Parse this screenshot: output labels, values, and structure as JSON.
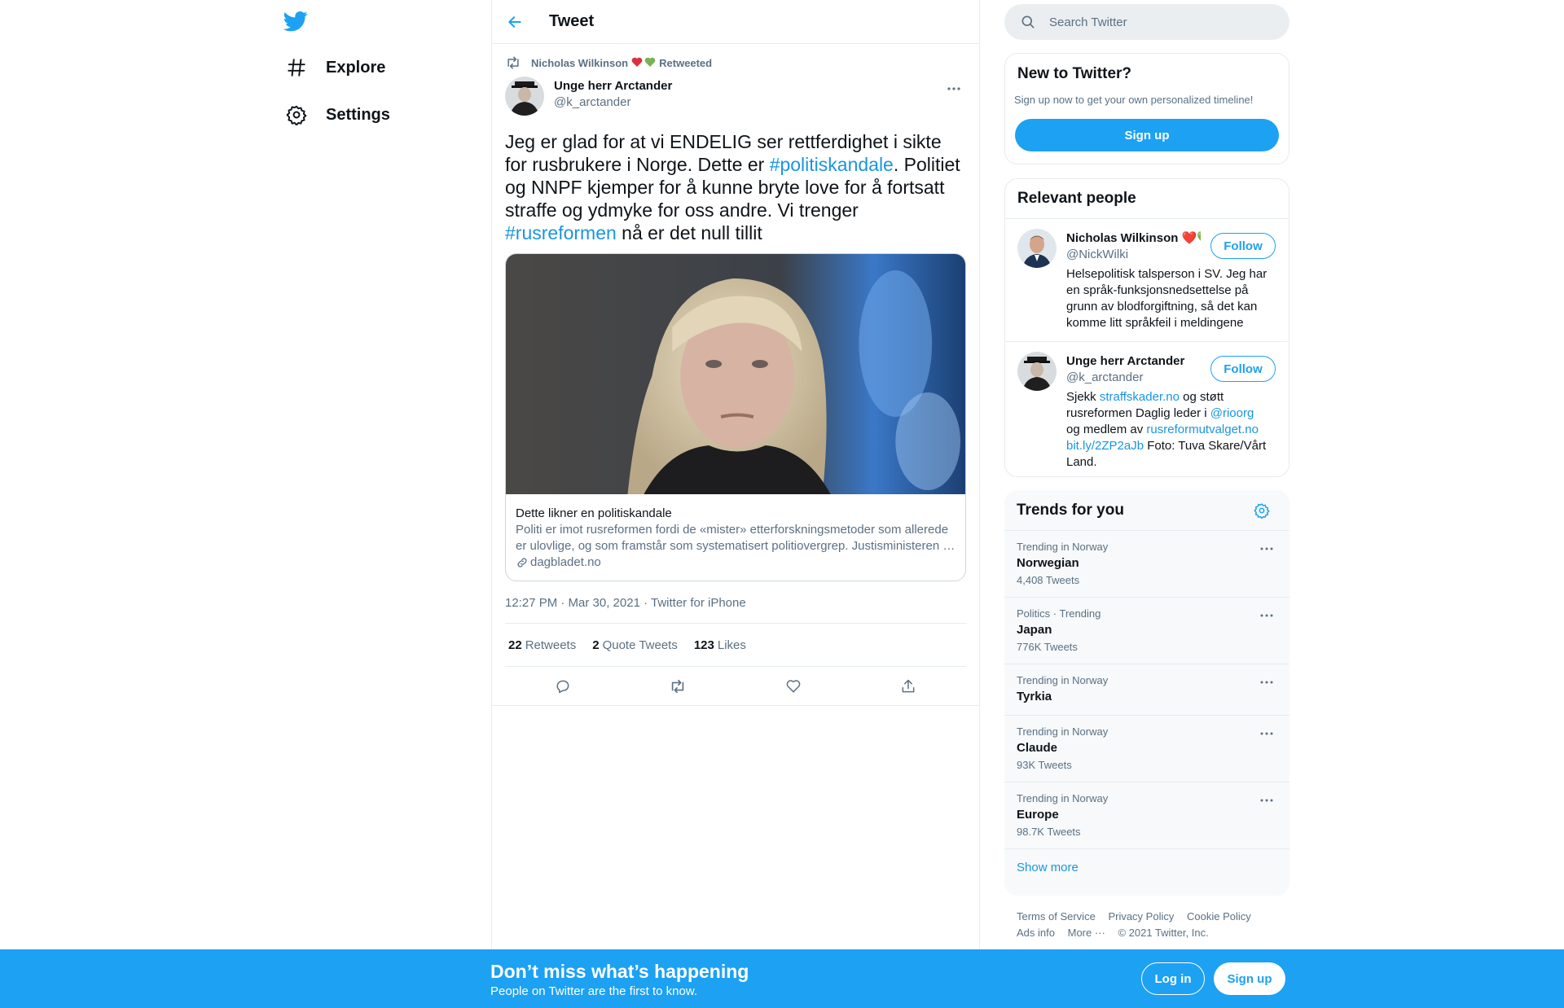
{
  "nav": {
    "logo": "twitter-bird-icon",
    "items": [
      {
        "label": "Explore",
        "icon": "hashtag-icon"
      },
      {
        "label": "Settings",
        "icon": "gear-icon"
      }
    ]
  },
  "header": {
    "title": "Tweet"
  },
  "tweet": {
    "retweeted_by": "Nicholas Wilkinson",
    "retweeted_emoji": "❤️💚",
    "retweeted_label": "Retweeted",
    "author_name": "Unge herr Arctander",
    "author_handle": "@k_arctander",
    "text_parts": {
      "p1": "Jeg er glad for at vi ENDELIG ser rettferdighet i sikte for rusbrukere i Norge. Dette er ",
      "tag1": "#politiskandale",
      "p2": ". Politiet og NNPF kjemper for å kunne bryte love for å fortsatt straffe og ydmyke for oss andre. Vi trenger ",
      "tag2": "#rusreformen",
      "p3": " nå er det null tillit"
    },
    "card": {
      "title": "Dette likner en politiskandale",
      "description": "Politi er imot rusreformen fordi de «mister» etterforskningsmetoder som allerede er ulovlige, og som framstår som systematisert politiovergrep. Justisministeren …",
      "domain": "dagbladet.no"
    },
    "meta": "12:27 PM · Mar 30, 2021 · Twitter for iPhone",
    "stats": {
      "retweets_count": "22",
      "retweets_label": "Retweets",
      "quotes_count": "2",
      "quotes_label": "Quote Tweets",
      "likes_count": "123",
      "likes_label": "Likes"
    }
  },
  "search": {
    "placeholder": "Search Twitter"
  },
  "new_to_twitter": {
    "title": "New to Twitter?",
    "subtitle": "Sign up now to get your own personalized timeline!",
    "button": "Sign up"
  },
  "relevant_people": {
    "title": "Relevant people",
    "people": [
      {
        "name": "Nicholas Wilkinson ❤️💚",
        "handle": "@NickWilki",
        "bio": "Helsepolitisk talsperson i SV. Jeg har en språk-funksjonsnedsettelse på grunn av blodforgiftning, så det kan komme litt språkfeil i meldingene",
        "button": "Follow"
      },
      {
        "name": "Unge herr Arctander",
        "handle": "@k_arctander",
        "bio_parts": {
          "a": "Sjekk ",
          "l1": "straffskader.no",
          "b": " og støtt rusreformen Daglig leder i ",
          "l2": "@rioorg",
          "c": " og medlem av ",
          "l3": "rusreformutvalget.no",
          "l4": "bit.ly/2ZP2aJb",
          "d": " Foto: Tuva Skare/Vårt Land."
        },
        "button": "Follow"
      }
    ]
  },
  "trends": {
    "title": "Trends for you",
    "items": [
      {
        "context": "Trending in Norway",
        "name": "Norwegian",
        "count": "4,408 Tweets"
      },
      {
        "context": "Politics · Trending",
        "name": "Japan",
        "count": "776K Tweets"
      },
      {
        "context": "Trending in Norway",
        "name": "Tyrkia",
        "count": ""
      },
      {
        "context": "Trending in Norway",
        "name": "Claude",
        "count": "93K Tweets"
      },
      {
        "context": "Trending in Norway",
        "name": "Europe",
        "count": "98.7K Tweets"
      }
    ],
    "show_more": "Show more"
  },
  "footer": {
    "links": [
      "Terms of Service",
      "Privacy Policy",
      "Cookie Policy",
      "Ads info",
      "More ···"
    ],
    "copyright": "© 2021 Twitter, Inc."
  },
  "bottom_bar": {
    "title": "Don’t miss what’s happening",
    "subtitle": "People on Twitter are the first to know.",
    "login": "Log in",
    "signup": "Sign up"
  },
  "colors": {
    "accent": "#1da1f2",
    "link": "#1b95e0",
    "muted": "#5b7083"
  }
}
